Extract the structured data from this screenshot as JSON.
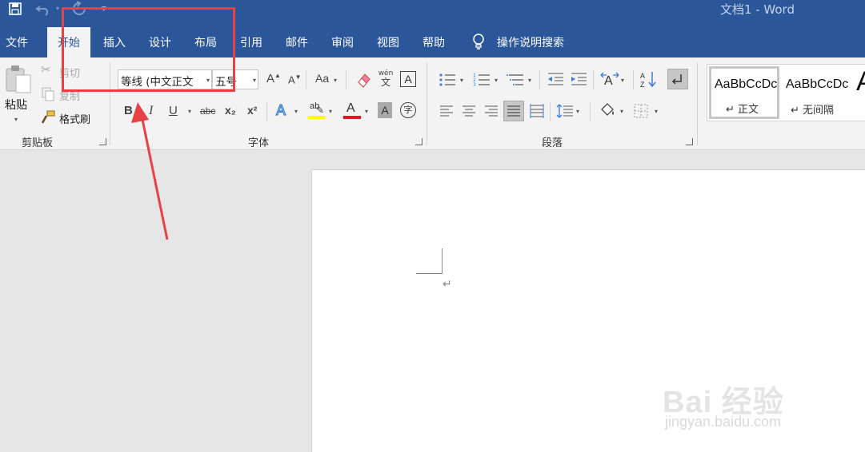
{
  "window": {
    "title": "文档1  -  Word"
  },
  "colors": {
    "brand": "#2b579a",
    "annotation": "#e84144",
    "font_color_bar": "#e81123",
    "highlight_bar": "#ffff00"
  },
  "quick_access": {
    "icons": [
      "save-icon",
      "undo-icon",
      "redo-icon",
      "customize-icon"
    ]
  },
  "tabs": [
    {
      "label": "文件"
    },
    {
      "label": "开始",
      "active": true
    },
    {
      "label": "插入"
    },
    {
      "label": "设计"
    },
    {
      "label": "布局"
    },
    {
      "label": "引用"
    },
    {
      "label": "邮件"
    },
    {
      "label": "审阅"
    },
    {
      "label": "视图"
    },
    {
      "label": "帮助"
    }
  ],
  "tell_me": {
    "label": "操作说明搜索"
  },
  "clipboard": {
    "paste_label": "粘贴",
    "cut_label": "剪切",
    "copy_label": "复制",
    "format_painter_label": "格式刷",
    "group_label": "剪贴板"
  },
  "font": {
    "font_name": "等线 (中文正文",
    "font_size": "五号",
    "group_label": "字体",
    "bold": "B",
    "italic": "I",
    "underline": "U",
    "strikethrough": "abc",
    "subscript": "x₂",
    "superscript": "x²",
    "change_case": "Aa",
    "phonetic_top": "wén",
    "phonetic_bottom": "文",
    "char_border": "A",
    "grow": "A",
    "shrink": "A",
    "text_effects": "A",
    "highlight": "ab",
    "font_color": "A",
    "char_shading": "A",
    "enclose": "字"
  },
  "paragraph": {
    "group_label": "段落"
  },
  "styles": {
    "items": [
      {
        "sample": "AaBbCcDc",
        "name": "正文"
      },
      {
        "sample": "AaBbCcDc",
        "name": "无间隔"
      },
      {
        "sample": "A",
        "name": ""
      }
    ]
  },
  "document": {
    "paragraph_mark": "↵"
  },
  "watermark": {
    "brand": "Bai 经验",
    "site": "jingyan.baidu.com"
  }
}
